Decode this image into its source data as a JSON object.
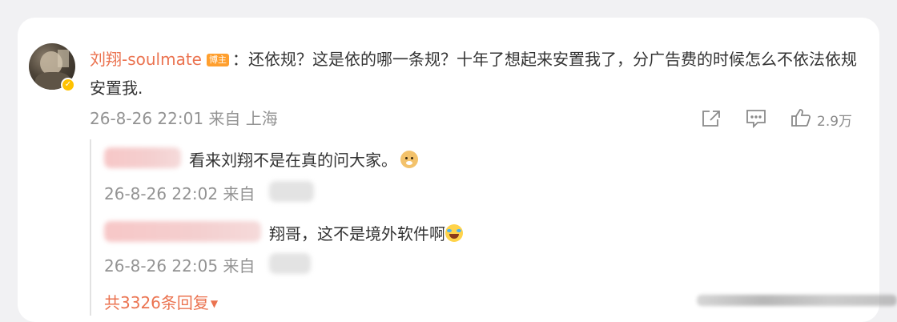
{
  "comment": {
    "username": "刘翔-soulmate",
    "badge": "博主",
    "separator": "：",
    "text": "还依规？这是依的哪一条规？十年了想起来安置我了，分广告费的时候怎么不依法依规安置我.",
    "timestamp": "26-8-26 22:01",
    "location": "来自 上海",
    "like_count": "2.9万"
  },
  "replies": [
    {
      "text": "看来刘翔不是在真的问大家。",
      "timestamp": "26-8-26 22:02",
      "location_prefix": "来自",
      "emoji": "doge-emoji"
    },
    {
      "text": "翔哥，这不是境外软件啊",
      "timestamp": "26-8-26 22:05",
      "location_prefix": "来自",
      "emoji": "laugh-cry-emoji"
    }
  ],
  "more_replies_label": "共3326条回复",
  "icons": {
    "verified": "verified-badge-icon",
    "share": "share-icon",
    "comment": "comment-icon",
    "like": "thumbs-up-icon",
    "expand": "caret-down-icon"
  },
  "colors": {
    "username": "#eb7350",
    "meta": "#939393",
    "badge": "#ff9f2e"
  }
}
